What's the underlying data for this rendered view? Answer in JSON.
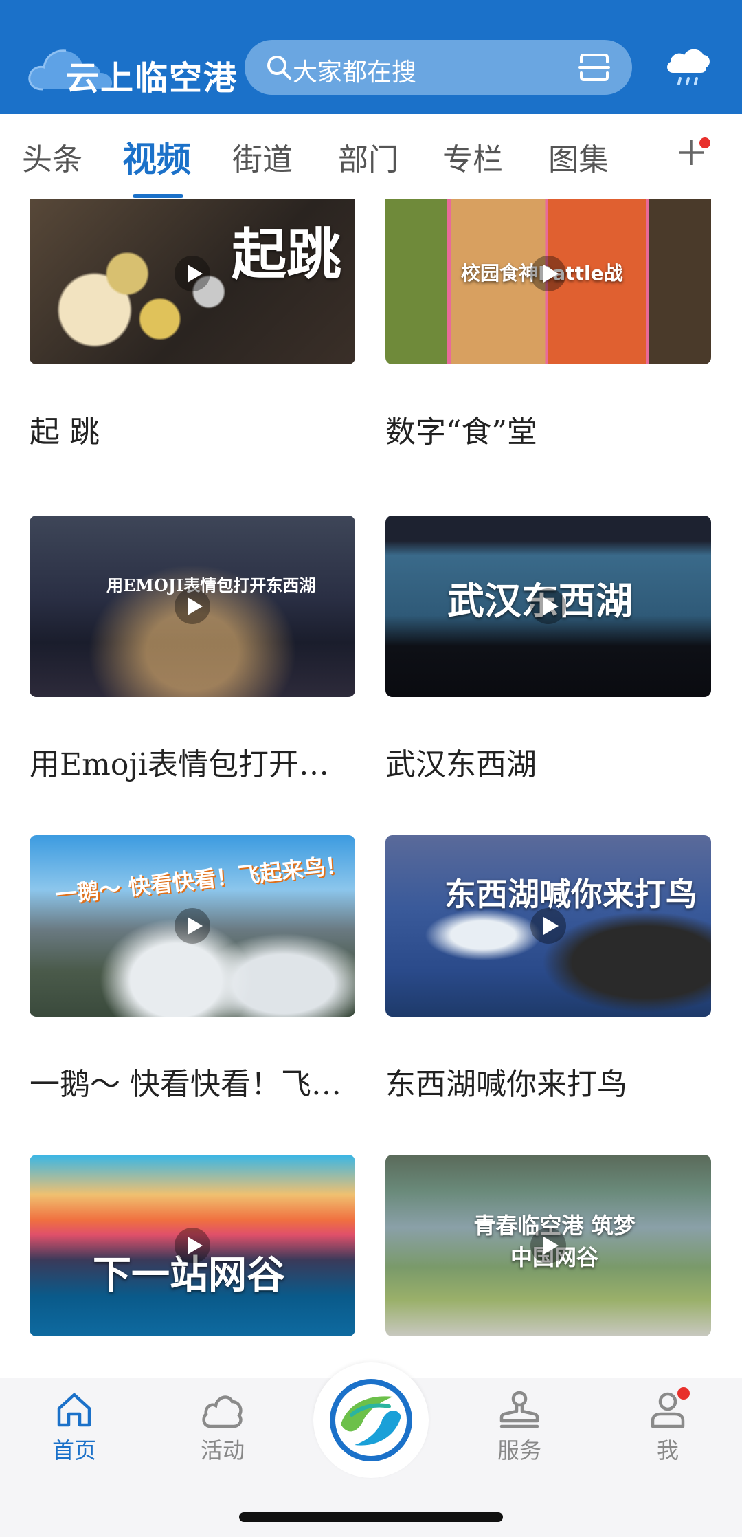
{
  "header": {
    "logo_text": "云上临空港",
    "search_placeholder": "大家都在搜",
    "icons": [
      "cloud-logo-icon",
      "search-icon",
      "scan-icon",
      "weather-icon"
    ]
  },
  "tabs": [
    {
      "label": "头条",
      "active": false
    },
    {
      "label": "视频",
      "active": true
    },
    {
      "label": "街道",
      "active": false
    },
    {
      "label": "部门",
      "active": false
    },
    {
      "label": "专栏",
      "active": false
    },
    {
      "label": "图集",
      "active": false
    }
  ],
  "videos": [
    {
      "title": "起 跳",
      "thumb_text": "起跳"
    },
    {
      "title": "数字“食”堂",
      "thumb_text": "校园食神Battle战"
    },
    {
      "title": "用Emoji表情包打开…",
      "thumb_text": "用EMOJI表情包打开东西湖"
    },
    {
      "title": "武汉东西湖",
      "thumb_text": "武汉东西湖"
    },
    {
      "title": "一鹅～ 快看快看！飞…",
      "thumb_text": "一鹅～ 快看快看！飞起来鸟！"
    },
    {
      "title": "东西湖喊你来打鸟",
      "thumb_text": "东西湖喊你来打鸟"
    },
    {
      "title": "",
      "thumb_text": "下一站网谷"
    },
    {
      "title": "",
      "thumb_text": "青春临空港 筑梦中国网谷"
    }
  ],
  "bottom_nav": [
    {
      "label": "首页",
      "icon": "home-icon",
      "active": true
    },
    {
      "label": "活动",
      "icon": "activity-icon",
      "active": false
    },
    {
      "label": "",
      "icon": "center-logo-icon",
      "active": false
    },
    {
      "label": "服务",
      "icon": "service-stamp-icon",
      "active": false
    },
    {
      "label": "我",
      "icon": "profile-icon",
      "active": false
    }
  ],
  "colors": {
    "brand": "#1b71c9",
    "badge": "#e8302c",
    "search_bg": "#6aa6e1"
  }
}
